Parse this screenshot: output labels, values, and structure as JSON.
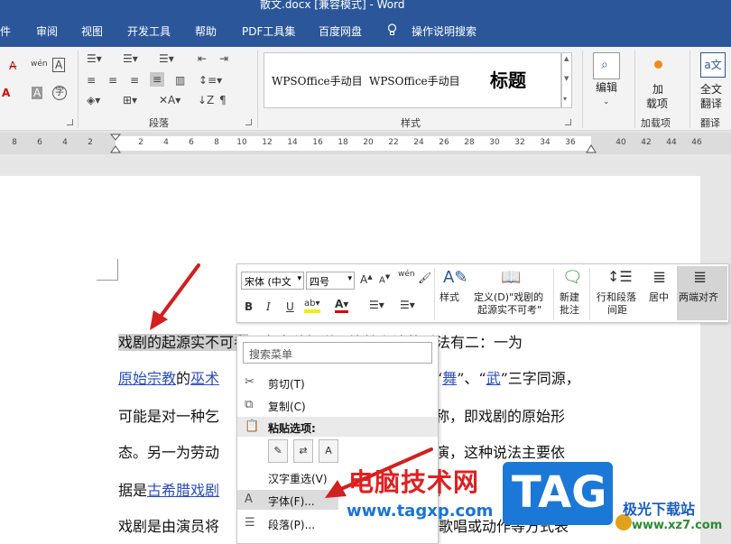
{
  "window": {
    "title": "散文.docx [兼容模式]  -  Word"
  },
  "menu": {
    "tabs": [
      "件",
      "审阅",
      "视图",
      "开发工具",
      "帮助",
      "PDF工具集",
      "百度网盘",
      "操作说明搜索"
    ]
  },
  "ribbon": {
    "font_glyphs": {
      "wen": "wén",
      "a_box": "A",
      "zi_circle": "字",
      "a_red": "A",
      "a_gray": "A"
    },
    "groups": {
      "paragraph": "段落",
      "styles": "样式",
      "addins": "加载项",
      "translate": "翻译"
    },
    "styles": [
      "WPSOffice手动目",
      "WPSOffice手动目",
      "标题"
    ],
    "buttons": {
      "edit": "编辑",
      "addin_line1": "加",
      "addin_line2": "载项",
      "translate_line1": "全文",
      "translate_line2": "翻译"
    },
    "colors": {
      "title_bar": "#2b579a"
    }
  },
  "ruler": {
    "numbers": [
      "8",
      "6",
      "4",
      "2",
      "2",
      "4",
      "6",
      "8",
      "10",
      "12",
      "14",
      "16",
      "18",
      "20",
      "22",
      "24",
      "26",
      "28",
      "30",
      "32",
      "34",
      "36",
      "40",
      "42",
      "44",
      "46"
    ]
  },
  "document": {
    "line1_sel": "戏剧的起源实不可考",
    "line1_rest": "，有多种假说，比较主流的看法有二：一为",
    "line2_link1": "原始宗教",
    "line2_de": "的",
    "line2_link2": "巫术",
    "line2_q1": "“",
    "line2_link3": "舞",
    "line2_mid": "”、“",
    "line2_link4": "武",
    "line2_end": "”三字同源，",
    "line3_start": "可能是对一种乞",
    "line3_end": "称，即戏剧的原始形",
    "line4_start": "态。另一为劳动",
    "line4_end": "演，这种说法主要依",
    "line5_start": "据是",
    "line5_link": "古希腊戏剧",
    "line5_end": "。",
    "line6_start": "戏剧是由演员将",
    "line6_end": "歌唱或动作等方式表"
  },
  "mini_toolbar": {
    "font_name": "宋体 (中文",
    "font_size": "四号",
    "bold": "B",
    "italic": "I",
    "underline": "U",
    "styles": "样式",
    "define_line1": "定义(D)\"戏剧的",
    "define_line2": "起源实不可考\"",
    "comment_line1": "新建",
    "comment_line2": "批注",
    "spacing_line1": "行和段落",
    "spacing_line2": "间距",
    "center": "居中",
    "justify": "两端对齐"
  },
  "context_menu": {
    "search_placeholder": "搜索菜单",
    "cut": "剪切(T)",
    "copy": "复制(C)",
    "paste_options": "粘贴选项:",
    "reconvert": "汉字重选(V)",
    "font": "字体(F)...",
    "paragraph": "段落(P)..."
  },
  "watermark": {
    "text": "电脑技术网",
    "url": "www.tagxp.com",
    "logo": "TAG",
    "site_name": "极光下载站",
    "site_url": "www.xz7.com"
  }
}
